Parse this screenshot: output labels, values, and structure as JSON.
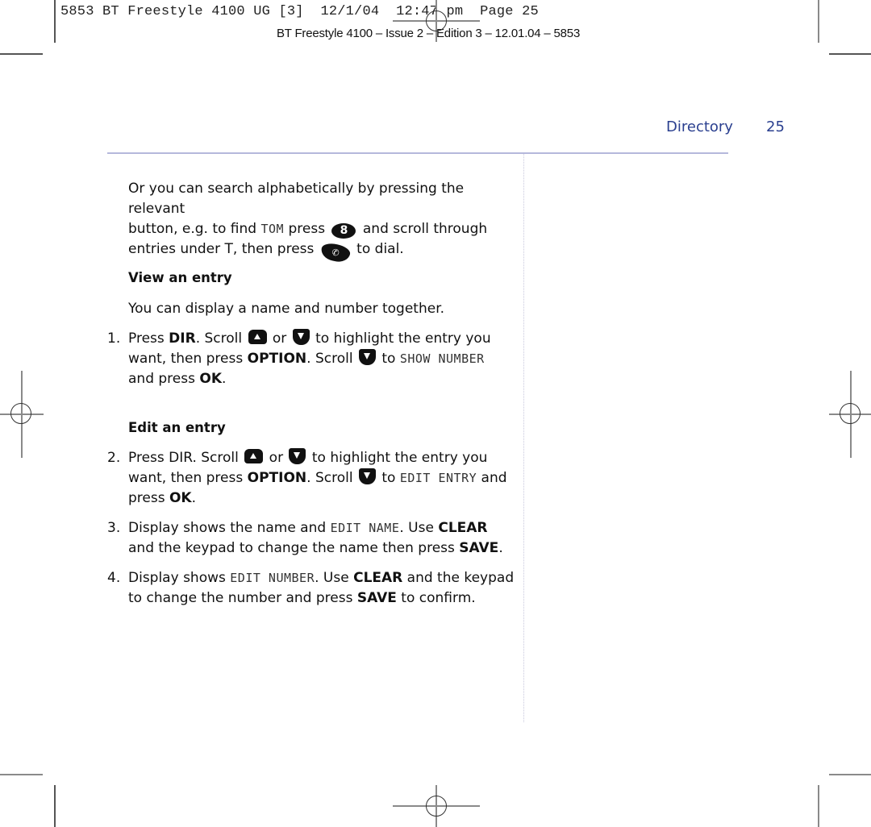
{
  "print_slug": "5853 BT Freestyle 4100 UG [3]  12/1/04  12:47 pm  Page 25",
  "edition_line": "BT Freestyle 4100 – Issue 2 – Edition 3 – 12.01.04 – 5853",
  "header": {
    "section": "Directory",
    "page_number": "25"
  },
  "intro": {
    "line1": "Or you can search alphabetically by pressing the relevant",
    "line2_a": "button, e.g. to find ",
    "line2_lcd": "TOM",
    "line2_b": " press ",
    "key_8": "8",
    "line2_c": " and scroll through",
    "line3_a": "entries under T, then press ",
    "line3_b": " to dial."
  },
  "view_entry": {
    "heading": "View an entry",
    "description": "You can display a name and number together.",
    "step1": {
      "number": "1.",
      "a": "Press ",
      "dir": "DIR",
      "b": ". Scroll ",
      "or": " or ",
      "c": " to highlight the entry you",
      "d": "want, then press ",
      "option": "OPTION",
      "e": ". Scroll ",
      "f": " to ",
      "lcd": "SHOW NUMBER",
      "g": "and press ",
      "ok": "OK",
      "h": "."
    }
  },
  "edit_entry": {
    "heading": "Edit an entry",
    "step2": {
      "number": "2.",
      "a": "Press DIR. Scroll ",
      "or": " or ",
      "c": " to highlight the entry you",
      "d": "want, then press ",
      "option": "OPTION",
      "e": ". Scroll ",
      "f": " to ",
      "lcd": "EDIT ENTRY",
      "g": " and",
      "h": "press ",
      "ok": "OK",
      "i": "."
    },
    "step3": {
      "number": "3.",
      "a": "Display shows the name and ",
      "lcd": "EDIT NAME",
      "b": ". Use ",
      "clear": "CLEAR",
      "c": "and the keypad to change the name then press ",
      "save": "SAVE",
      "d": "."
    },
    "step4": {
      "number": "4.",
      "a": "Display shows ",
      "lcd": "EDIT NUMBER",
      "b": ". Use ",
      "clear": "CLEAR",
      "c": " and the keypad",
      "d": "to change the number and press ",
      "save": "SAVE",
      "e": " to confirm."
    }
  }
}
